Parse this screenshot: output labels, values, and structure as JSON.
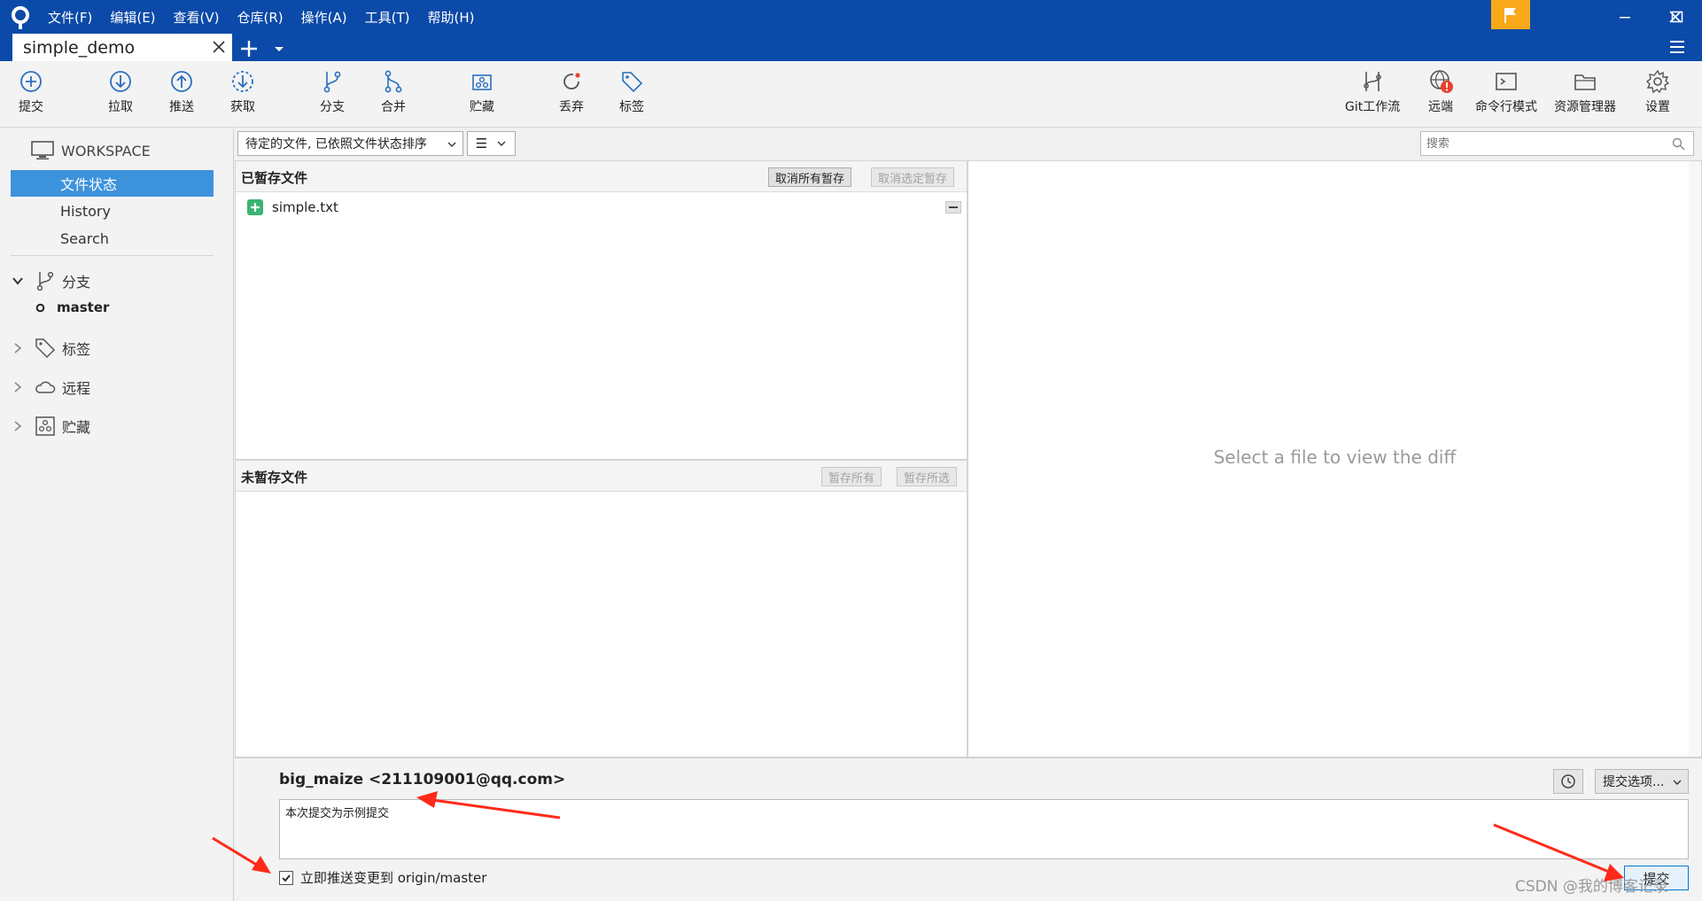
{
  "menu": [
    "文件(F)",
    "编辑(E)",
    "查看(V)",
    "仓库(R)",
    "操作(A)",
    "工具(T)",
    "帮助(H)"
  ],
  "tab": {
    "title": "simple_demo"
  },
  "toolbar": {
    "commit": "提交",
    "pull": "拉取",
    "push": "推送",
    "fetch": "获取",
    "branch": "分支",
    "merge": "合并",
    "stash": "贮藏",
    "discard": "丢弃",
    "tag": "标签",
    "gitflow": "Git工作流",
    "remote": "远端",
    "terminal": "命令行模式",
    "explorer": "资源管理器",
    "settings": "设置"
  },
  "sidebar": {
    "workspace": "WORKSPACE",
    "file_status": "文件状态",
    "history": "History",
    "search": "Search",
    "branches": "分支",
    "branch_master": "master",
    "tags": "标签",
    "remotes": "远程",
    "stashes": "贮藏"
  },
  "filter": {
    "sort": "待定的文件, 已依照文件状态排序",
    "view_icon": "☰",
    "search_placeholder": "搜索"
  },
  "staged": {
    "title": "已暂存文件",
    "unstage_all": "取消所有暂存",
    "unstage_selected": "取消选定暂存",
    "files": [
      {
        "name": "simple.txt",
        "status": "added"
      }
    ]
  },
  "unstaged": {
    "title": "未暂存文件",
    "stage_all": "暂存所有",
    "stage_selected": "暂存所选"
  },
  "diff": {
    "placeholder": "Select a file to view the diff"
  },
  "commit": {
    "author": "big_maize <211109001@qq.com>",
    "message": "本次提交为示例提交",
    "options": "提交选项...",
    "push_label": "立即推送变更到 origin/master",
    "push_checked": true,
    "submit": "提交"
  },
  "watermark": "CSDN @我的博客记录",
  "colors": {
    "titlebar": "#0b4aa8",
    "accent": "#3d92dc",
    "flag": "#f9a81a",
    "icon": "#2a6fc0",
    "added": "#3cb371",
    "annotation": "#ff2a1a"
  }
}
